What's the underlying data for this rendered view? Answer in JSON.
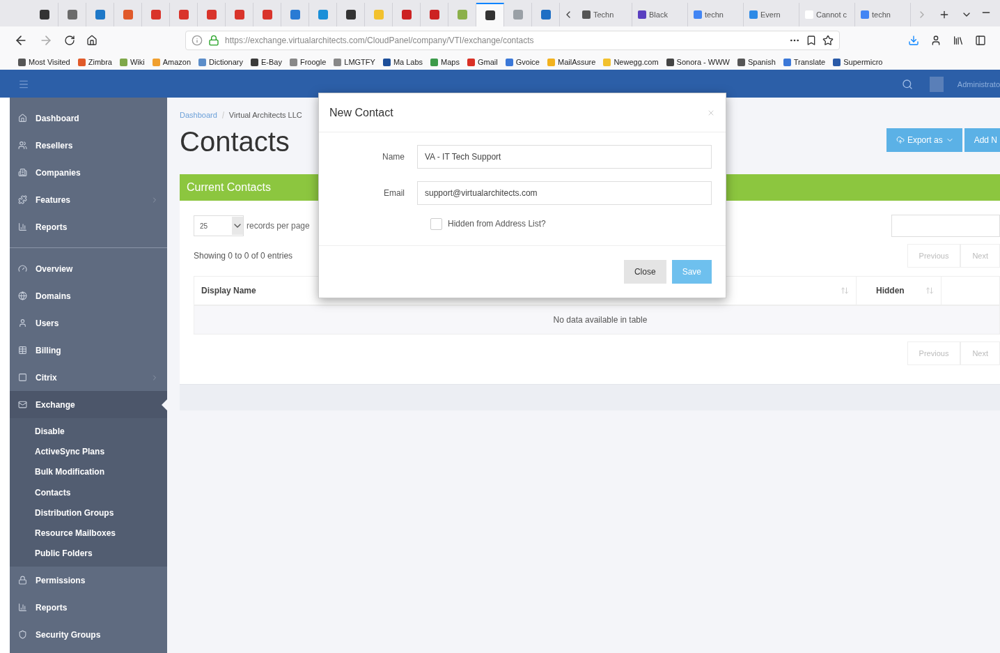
{
  "browser": {
    "pinned_tabs": [
      {
        "color": "#333333",
        "selected": false
      },
      {
        "color": "#6b6b6b",
        "selected": false
      },
      {
        "color": "#1e78c8",
        "selected": false
      },
      {
        "color": "#e05a2a",
        "selected": false
      },
      {
        "color": "#d9342b",
        "selected": false
      },
      {
        "color": "#d9342b",
        "selected": false
      },
      {
        "color": "#d9342b",
        "selected": false
      },
      {
        "color": "#d9342b",
        "selected": false
      },
      {
        "color": "#d9342b",
        "selected": false
      },
      {
        "color": "#2a7bd4",
        "selected": false
      },
      {
        "color": "#1a8fd8",
        "selected": false
      },
      {
        "color": "#333333",
        "selected": false
      },
      {
        "color": "#f2c12e",
        "selected": false
      },
      {
        "color": "#cc2222",
        "selected": false
      },
      {
        "color": "#cc2222",
        "selected": false
      },
      {
        "color": "#8bb04a",
        "selected": false
      },
      {
        "color": "#333333",
        "selected": true
      },
      {
        "color": "#9aa0a6",
        "selected": false
      },
      {
        "color": "#1f6fc4",
        "selected": false
      }
    ],
    "tabs": [
      {
        "label": "Techn",
        "color": "#555555"
      },
      {
        "label": "Black",
        "color": "#5a3fc0"
      },
      {
        "label": "techn",
        "color": "#4285f4"
      },
      {
        "label": "Evern",
        "color": "#2d8ae6"
      },
      {
        "label": "Cannot c",
        "color": "#ffffff"
      },
      {
        "label": "techn",
        "color": "#4285f4"
      }
    ],
    "url": "https://exchange.virtualarchitects.com/CloudPanel/company/VTI/exchange/contacts",
    "bookmarks": [
      {
        "label": "Most Visited",
        "color": "#555555"
      },
      {
        "label": "Zimbra",
        "color": "#e05a2a"
      },
      {
        "label": "Wiki",
        "color": "#7fa84a"
      },
      {
        "label": "Amazon",
        "color": "#f0a030"
      },
      {
        "label": "Dictionary",
        "color": "#5b8dc9"
      },
      {
        "label": "E-Bay",
        "color": "#3a3a3a"
      },
      {
        "label": "Froogle",
        "color": "#888888"
      },
      {
        "label": "LMGTFY",
        "color": "#888888"
      },
      {
        "label": "Ma Labs",
        "color": "#1d4f9a"
      },
      {
        "label": "Maps",
        "color": "#3c9a4a"
      },
      {
        "label": "Gmail",
        "color": "#d93025"
      },
      {
        "label": "Gvoice",
        "color": "#3b78d8"
      },
      {
        "label": "MailAssure",
        "color": "#f2b21e"
      },
      {
        "label": "Newegg.com",
        "color": "#f2c12e"
      },
      {
        "label": "Sonora - WWW",
        "color": "#444444"
      },
      {
        "label": "Spanish",
        "color": "#555555"
      },
      {
        "label": "Translate",
        "color": "#3b78d8"
      },
      {
        "label": "Supermicro",
        "color": "#2a5aa8"
      }
    ]
  },
  "header": {
    "user": "Administrato"
  },
  "sidebar": {
    "sections": [
      {
        "items": [
          {
            "label": "Dashboard",
            "kind": "link",
            "selected": false
          },
          {
            "label": "Resellers",
            "kind": "link",
            "selected": false
          },
          {
            "label": "Companies",
            "kind": "link",
            "selected": false
          },
          {
            "label": "Features",
            "kind": "group",
            "expanded": false,
            "selected": false
          },
          {
            "label": "Reports",
            "kind": "link",
            "selected": false
          }
        ]
      },
      {
        "items": [
          {
            "label": "Overview",
            "kind": "link",
            "selected": false
          },
          {
            "label": "Domains",
            "kind": "link",
            "selected": false
          },
          {
            "label": "Users",
            "kind": "link",
            "selected": false
          },
          {
            "label": "Billing",
            "kind": "link",
            "selected": false
          },
          {
            "label": "Citrix",
            "kind": "group",
            "expanded": false,
            "selected": false
          },
          {
            "label": "Exchange",
            "kind": "group",
            "expanded": true,
            "selected": true,
            "children": [
              {
                "label": "Disable"
              },
              {
                "label": "ActiveSync Plans"
              },
              {
                "label": "Bulk Modification"
              },
              {
                "label": "Contacts"
              },
              {
                "label": "Distribution Groups"
              },
              {
                "label": "Resource Mailboxes"
              },
              {
                "label": "Public Folders"
              }
            ]
          },
          {
            "label": "Permissions",
            "kind": "link",
            "selected": false
          },
          {
            "label": "Reports",
            "kind": "link",
            "selected": false
          },
          {
            "label": "Security Groups",
            "kind": "link",
            "selected": false
          }
        ]
      }
    ]
  },
  "breadcrumb": [
    {
      "label": "Dashboard",
      "kind": "link"
    },
    {
      "label": "Virtual Architects LLC",
      "kind": "text"
    }
  ],
  "title": "Contacts",
  "actions": [
    {
      "label": "Export as",
      "kind": "dropdown"
    },
    {
      "label": "Add N",
      "kind": "plain"
    }
  ],
  "panel": {
    "title": "Current Contacts",
    "page_size": "25",
    "page_size_label": "records per page",
    "info": "Showing 0 to 0 of 0 entries",
    "pagination": [
      "Previous",
      "Next"
    ],
    "columns": [
      "Display Name",
      "Hidden"
    ],
    "empty": "No data available in table",
    "pagination_bottom": [
      "Previous",
      "Next"
    ]
  },
  "modal": {
    "title": "New Contact",
    "fields": [
      {
        "label": "Name",
        "value": "VA - IT Tech Support"
      },
      {
        "label": "Email",
        "value": "support@virtualarchitects.com"
      }
    ],
    "checkbox": {
      "label": "Hidden from Address List?",
      "checked": false
    },
    "buttons": [
      {
        "label": "Close",
        "kind": "secondary"
      },
      {
        "label": "Save",
        "kind": "primary"
      }
    ]
  }
}
